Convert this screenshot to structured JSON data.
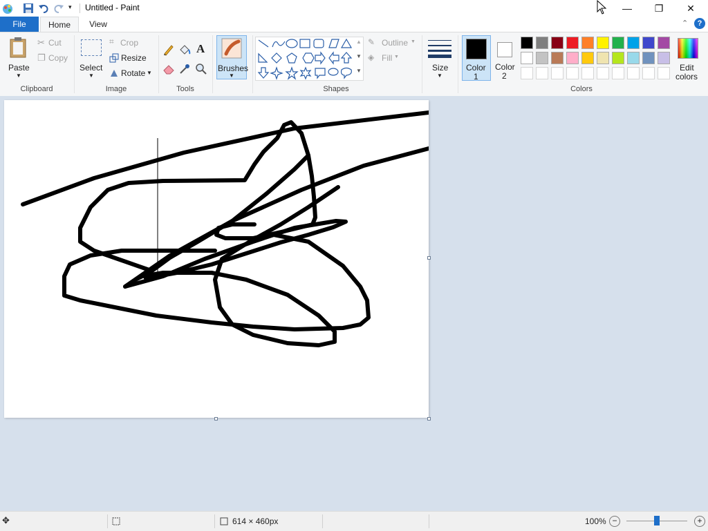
{
  "window": {
    "title": "Untitled - Paint",
    "minimize": "—",
    "maximize": "❐",
    "close": "✕"
  },
  "tabs": {
    "file": "File",
    "home": "Home",
    "view": "View"
  },
  "clipboard": {
    "paste": "Paste",
    "cut": "Cut",
    "copy": "Copy",
    "label": "Clipboard"
  },
  "image": {
    "select": "Select",
    "crop": "Crop",
    "resize": "Resize",
    "rotate": "Rotate",
    "label": "Image"
  },
  "tools": {
    "label": "Tools",
    "text_glyph": "A"
  },
  "brushes": {
    "label": "Brushes"
  },
  "shapes": {
    "outline": "Outline",
    "fill": "Fill",
    "label": "Shapes"
  },
  "size": {
    "label": "Size"
  },
  "color1": {
    "label": "Color",
    "num": "1",
    "color": "#000000"
  },
  "color2": {
    "label": "Color",
    "num": "2",
    "color": "#ffffff"
  },
  "colors": {
    "label": "Colors",
    "edit_label": "Edit",
    "edit_label2": "colors",
    "row1": [
      "#000000",
      "#7f7f7f",
      "#880015",
      "#ed1c24",
      "#ff7f27",
      "#fff200",
      "#22b14c",
      "#00a2e8",
      "#3f48cc",
      "#a349a4"
    ],
    "row2": [
      "#ffffff",
      "#c3c3c3",
      "#b97a57",
      "#ffaec9",
      "#ffc90e",
      "#efe4b0",
      "#b5e61d",
      "#99d9ea",
      "#7092be",
      "#c8bfe7"
    ]
  },
  "status": {
    "canvas_size": "614 × 460px",
    "zoom": "100%",
    "zoom_level": 0.5
  },
  "help": "?"
}
